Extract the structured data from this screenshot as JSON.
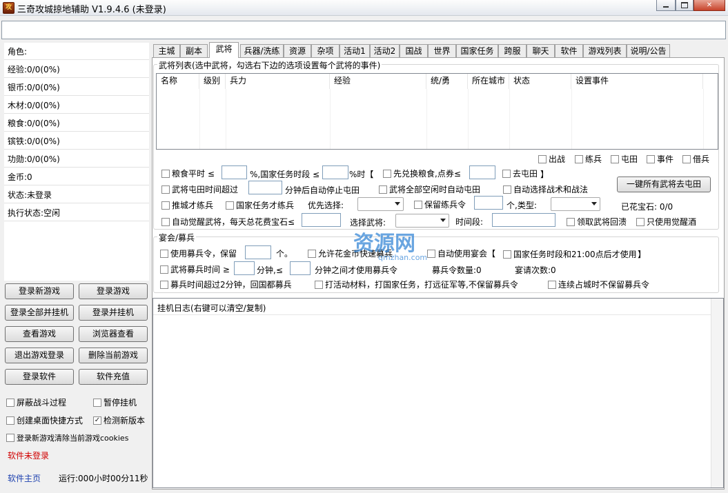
{
  "window": {
    "title": "三奇攻城掠地辅助 V1.9.4.6 (未登录)",
    "icon_text": "攻"
  },
  "url_bar": {
    "value": ""
  },
  "left_info": [
    "角色:",
    "经验:0/0(0%)",
    "银币:0/0(0%)",
    "木材:0/0(0%)",
    "粮食:0/0(0%)",
    "镔铁:0/0(0%)",
    "功勋:0/0(0%)",
    "金币:0",
    "状态:未登录",
    "执行状态:空闲"
  ],
  "left_buttons": [
    "登录新游戏",
    "登录游戏",
    "登录全部并挂机",
    "登录并挂机",
    "查看游戏",
    "浏览器查看",
    "退出游戏登录",
    "删除当前游戏",
    "登录软件",
    "软件充值"
  ],
  "left_options": {
    "block_battle": "屏蔽战斗过程",
    "pause": "暂停挂机",
    "desktop_shortcut": "创建桌面快捷方式",
    "check_update": "检测新版本",
    "clear_cookies": "登录新游戏清除当前游戏cookies"
  },
  "left_status": {
    "software_status": "软件未登录",
    "homepage": "软件主页",
    "runtime": "运行:000小时00分11秒"
  },
  "tabs": [
    "主城",
    "副本",
    "武将",
    "兵器/洗练",
    "资源",
    "杂项",
    "活动1",
    "活动2",
    "国战",
    "世界",
    "国家任务",
    "跨服",
    "聊天",
    "软件",
    "游戏列表",
    "说明/公告"
  ],
  "active_tab": "武将",
  "general_group": {
    "title": "武将列表(选中武将，勾选右下边的选项设置每个武将的事件)",
    "columns": [
      "名称",
      "级别",
      "兵力",
      "经验",
      "统/勇",
      "所在城市",
      "状态",
      "设置事件"
    ]
  },
  "event_checks": [
    "出战",
    "练兵",
    "屯田",
    "事件",
    "借兵"
  ],
  "settings": {
    "food_flat": "粮食平时 ≤",
    "pct_national": "%,国家任务时段 ≤",
    "pct_hour": "%时【",
    "exchange_first": "先兑换粮食,点券≤",
    "go_farm": "去屯田",
    "bracket_close": "】",
    "farm_time_over": "武将屯田时间超过",
    "minutes_stop": "分钟后自动停止屯田",
    "all_idle_farm": "武将全部空闲时自动屯田",
    "auto_tactics": "自动选择战术和战法",
    "all_farm_btn": "一键所有武将去屯田",
    "train_when_city": "推城才练兵",
    "train_when_national": "国家任务才练兵",
    "priority_label": "优先选择:",
    "keep_token": "保留练兵令",
    "type_label": "个,类型:",
    "gems_label": "已花宝石: 0/0",
    "auto_awaken": "自动觉醒武将，每天总花费宝石≤",
    "select_general": "选择武将:",
    "time_label": "时间段:",
    "claim_return": "领取武将回溃",
    "only_awaken_wine": "只使用觉醒酒"
  },
  "banquet_group": {
    "title": "宴会/募兵",
    "use_recruit": "使用募兵令，保留",
    "unit": "个。",
    "allow_gold": "允许花金币快速募兵",
    "auto_banquet": "自动使用宴会【",
    "national_after": "国家任务时段和21:00点后才使用",
    "bracket_close": "】",
    "recruit_time": "武将募兵时间 ≥",
    "minutes_le": "分钟,≤",
    "minutes_between": "分钟之间才使用募兵令",
    "recruit_count": "募兵令数量:0",
    "banquet_count": "宴请次数:0",
    "over_2min": "募兵时间超过2分钟，回国都募兵",
    "event_materials": "打活动材料，打国家任务，打远征军等,不保留募兵令",
    "continuous_capture": "连续占城时不保留募兵令"
  },
  "log": {
    "title": "挂机日志(右键可以清空/复制)"
  },
  "watermark": {
    "big": "资源网",
    "small": "qmzhan.com"
  },
  "checked": {
    "check_update": true
  }
}
